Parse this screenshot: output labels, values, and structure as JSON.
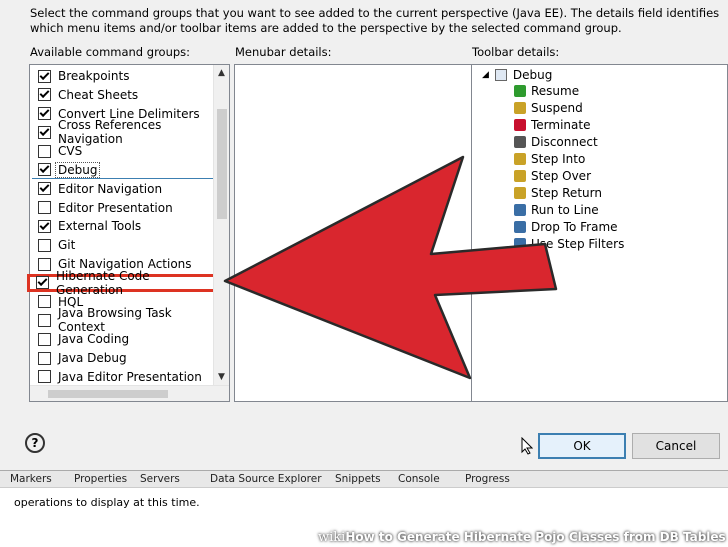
{
  "intro_text": "Select the command groups that you want to see added to the current perspective (Java EE).  The details field identifies which menu items and/or toolbar items are added to the perspective by the selected command group.",
  "labels": {
    "available": "Available command groups:",
    "menubar": "Menubar details:",
    "toolbar": "Toolbar details:"
  },
  "command_groups": [
    {
      "label": "Breakpoints",
      "checked": true
    },
    {
      "label": "Cheat Sheets",
      "checked": true
    },
    {
      "label": "Convert Line Delimiters",
      "checked": true
    },
    {
      "label": "Cross References Navigation",
      "checked": true
    },
    {
      "label": "CVS",
      "checked": false
    },
    {
      "label": "Debug",
      "checked": true,
      "selected": true
    },
    {
      "label": "Editor Navigation",
      "checked": true
    },
    {
      "label": "Editor Presentation",
      "checked": false
    },
    {
      "label": "External Tools",
      "checked": true
    },
    {
      "label": "Git",
      "checked": false
    },
    {
      "label": "Git Navigation Actions",
      "checked": false
    },
    {
      "label": "Hibernate Code Generation",
      "checked": true,
      "highlighted": true
    },
    {
      "label": "HQL",
      "checked": false
    },
    {
      "label": "Java Browsing Task Context",
      "checked": false
    },
    {
      "label": "Java Coding",
      "checked": false
    },
    {
      "label": "Java Debug",
      "checked": false
    },
    {
      "label": "Java Editor Presentation",
      "checked": false
    }
  ],
  "toolbar_tree": {
    "root": "Debug",
    "items": [
      {
        "label": "Resume",
        "icon": "resume-icon",
        "color": "#2e9b2e"
      },
      {
        "label": "Suspend",
        "icon": "suspend-icon",
        "color": "#c9a227"
      },
      {
        "label": "Terminate",
        "icon": "terminate-icon",
        "color": "#c8102e"
      },
      {
        "label": "Disconnect",
        "icon": "disconnect-icon",
        "color": "#555555"
      },
      {
        "label": "Step Into",
        "icon": "step-into-icon",
        "color": "#c9a227"
      },
      {
        "label": "Step Over",
        "icon": "step-over-icon",
        "color": "#c9a227"
      },
      {
        "label": "Step Return",
        "icon": "step-return-icon",
        "color": "#c9a227"
      },
      {
        "label": "Run to Line",
        "icon": "run-to-line-icon",
        "color": "#3a6ea5"
      },
      {
        "label": "Drop To Frame",
        "icon": "drop-to-frame-icon",
        "color": "#3a6ea5"
      },
      {
        "label": "Use Step Filters",
        "icon": "step-filters-icon",
        "color": "#3a6ea5"
      }
    ]
  },
  "buttons": {
    "help": "?",
    "ok": "OK",
    "cancel": "Cancel"
  },
  "views_tabs": [
    "Markers",
    "Properties",
    "Servers",
    "Data Source Explorer",
    "Snippets",
    "Console",
    "Progress"
  ],
  "views_message": "operations to display at this time.",
  "watermark": {
    "wiki": "wiki",
    "title": "How to Generate Hibernate Pojo Classes from DB Tables"
  },
  "colors": {
    "arrow": "#d9262e",
    "highlight": "#d32f2f"
  }
}
